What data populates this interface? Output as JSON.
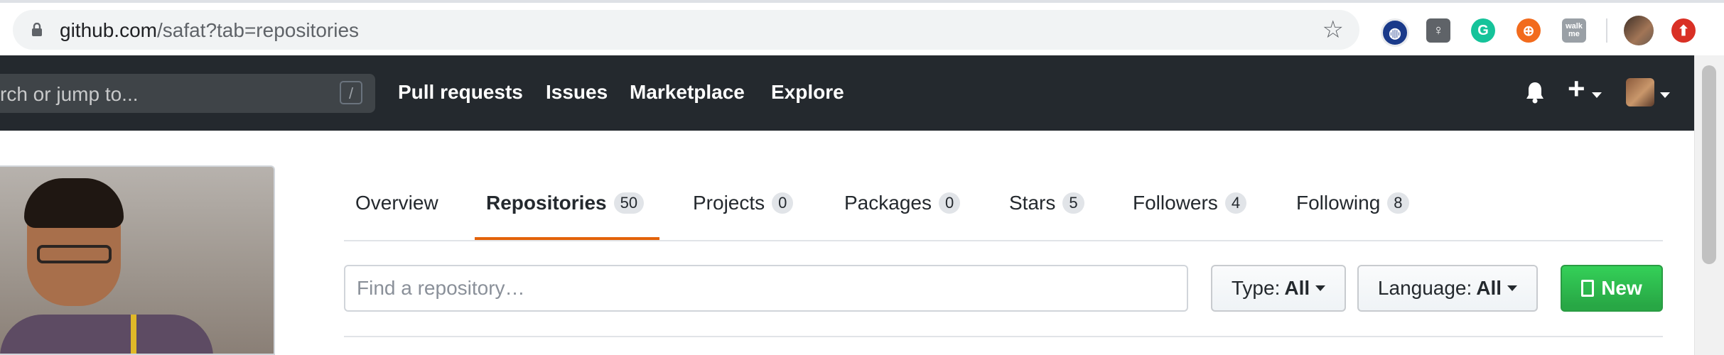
{
  "browser": {
    "url_host": "github.com",
    "url_path": "/safat?tab=repositories",
    "extensions": [
      {
        "name": "globe-extension-icon",
        "color": "#1a3a8a"
      },
      {
        "name": "lightbulb-extension-icon",
        "color": "#5f6368"
      },
      {
        "name": "grammarly-extension-icon",
        "color": "#15c39a",
        "glyph": "G"
      },
      {
        "name": "lifebuoy-extension-icon",
        "color": "#f26b1d"
      },
      {
        "name": "walkme-extension-icon",
        "color": "#9aa0a6",
        "glyph": "walk me"
      },
      {
        "name": "profile-avatar-icon",
        "color": "#6b5a4e"
      },
      {
        "name": "upload-extension-icon",
        "color": "#d93025"
      }
    ]
  },
  "header": {
    "search_placeholder": "rch or jump to...",
    "slash_hint": "/",
    "nav": [
      "Pull requests",
      "Issues",
      "Marketplace",
      "Explore"
    ],
    "plus": "+"
  },
  "tabs": [
    {
      "label": "Overview",
      "count": null
    },
    {
      "label": "Repositories",
      "count": "50",
      "active": true
    },
    {
      "label": "Projects",
      "count": "0"
    },
    {
      "label": "Packages",
      "count": "0"
    },
    {
      "label": "Stars",
      "count": "5"
    },
    {
      "label": "Followers",
      "count": "4"
    },
    {
      "label": "Following",
      "count": "8"
    }
  ],
  "filters": {
    "search_placeholder": "Find a repository…",
    "type_label": "Type:",
    "type_value": "All",
    "language_label": "Language:",
    "language_value": "All",
    "new_label": "New"
  },
  "colors": {
    "header_bg": "#24292e",
    "active_tab_underline": "#e36209",
    "new_button": "#28a745"
  }
}
